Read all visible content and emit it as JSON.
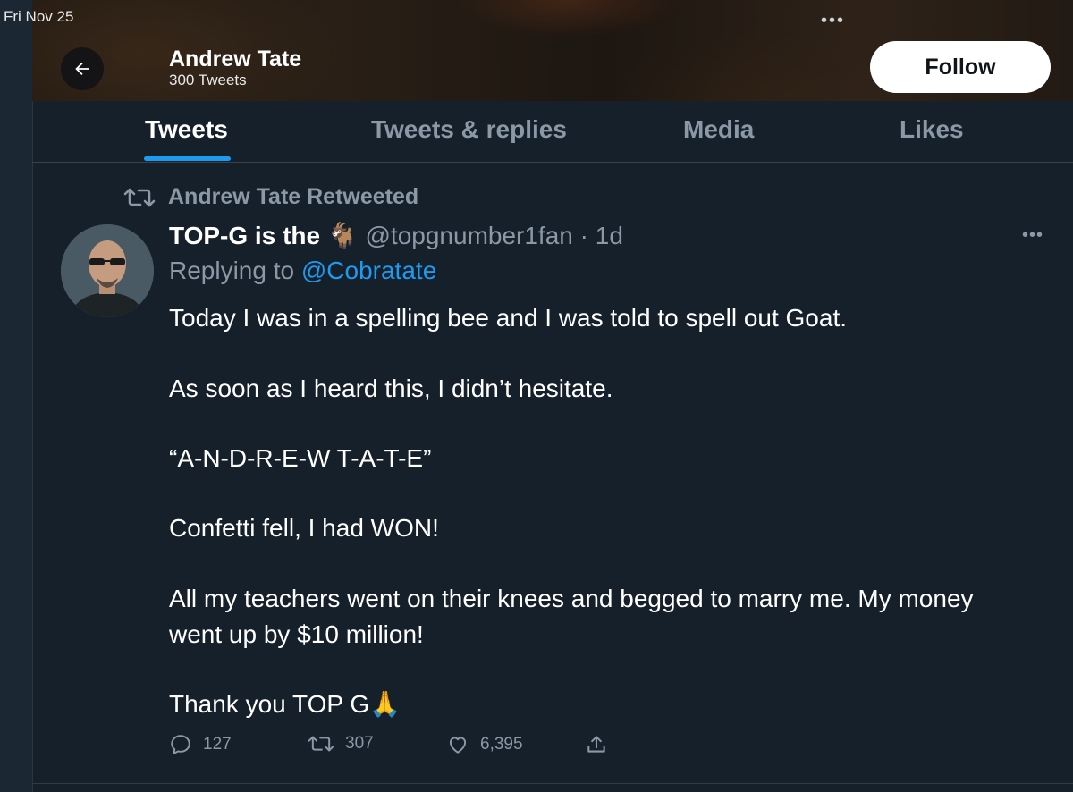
{
  "status_bar": {
    "date": "Fri Nov 25",
    "dots": "•••"
  },
  "header": {
    "name": "Andrew Tate",
    "tweet_count": "300 Tweets",
    "follow_label": "Follow"
  },
  "tabs": [
    {
      "label": "Tweets",
      "active": true
    },
    {
      "label": "Tweets & replies",
      "active": false
    },
    {
      "label": "Media",
      "active": false
    },
    {
      "label": "Likes",
      "active": false
    }
  ],
  "tweet": {
    "retweet_label": "Andrew Tate Retweeted",
    "author_name": "TOP-G is the 🐐",
    "handle": "@topgnumber1fan",
    "time": "· 1d",
    "replying_prefix": "Replying to",
    "replying_to": "@Cobratate",
    "more": "•••",
    "body": {
      "p1": "Today I was in a spelling bee and I was told to spell out Goat.",
      "p2": "As soon as I heard this, I didn’t hesitate.",
      "p3": "“A-N-D-R-E-W  T-A-T-E”",
      "p4": "Confetti fell, I had WON!",
      "p5_line1": "All my teachers went on their knees and begged to marry me. My money",
      "p5_line2": "went up by $10 million!",
      "p6": "Thank you TOP G🙏"
    },
    "stats": {
      "replies": "127",
      "retweets": "307",
      "likes": "6,395"
    }
  },
  "colors": {
    "accent": "#1d9bf0",
    "background": "#15202b",
    "muted": "#8b98a5"
  }
}
